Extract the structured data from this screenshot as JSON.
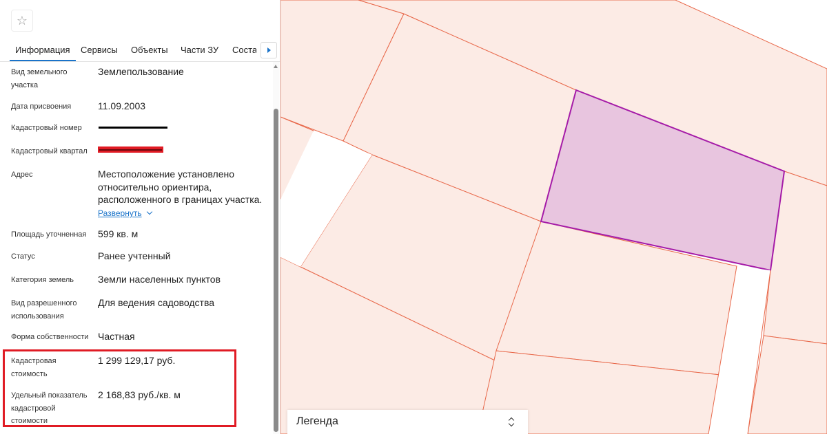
{
  "favorite_icon": "star-outline-icon",
  "tabs": [
    {
      "label": "Информация",
      "active": true
    },
    {
      "label": "Сервисы"
    },
    {
      "label": "Объекты"
    },
    {
      "label": "Части ЗУ"
    },
    {
      "label": "Состав"
    }
  ],
  "tab_next_icon": "chevron-right-icon",
  "fields": {
    "land_type": {
      "label": "Вид земельного участка",
      "value": "Землепользование"
    },
    "assign_date": {
      "label": "Дата присвоения",
      "value": "11.09.2003"
    },
    "cadastral_number": {
      "label": "Кадастровый номер",
      "value": ""
    },
    "cadastral_quarter": {
      "label": "Кадастровый квартал",
      "value": ""
    },
    "address": {
      "label": "Адрес",
      "value": "Местоположение установлено относительно ориентира, расположенного в границах участка.",
      "expand_label": "Развернуть"
    },
    "area": {
      "label": "Площадь уточненная",
      "value": "599 кв. м"
    },
    "status": {
      "label": "Статус",
      "value": "Ранее учтенный"
    },
    "land_category": {
      "label": "Категория земель",
      "value": "Земли населенных пунктов"
    },
    "permitted_use": {
      "label": "Вид разрешенного использования",
      "value": "Для ведения садоводства"
    },
    "ownership": {
      "label": "Форма собственности",
      "value": "Частная"
    },
    "cadastral_value": {
      "label": "Кадастровая стоимость",
      "value": "1 299 129,17 руб."
    },
    "specific_value": {
      "label": "Удельный показатель кадастровой стоимости",
      "value": "2 168,83 руб./кв. м"
    }
  },
  "legend": {
    "title": "Легенда",
    "toggle_icon": "chevron-up-down-icon"
  },
  "colors": {
    "accent": "#1a73c9",
    "highlight": "#e01b24",
    "parcel_fill": "#fcebe5",
    "parcel_line": "#e8684a",
    "selected_fill": "#e8c5df",
    "selected_line": "#a51ba8"
  }
}
